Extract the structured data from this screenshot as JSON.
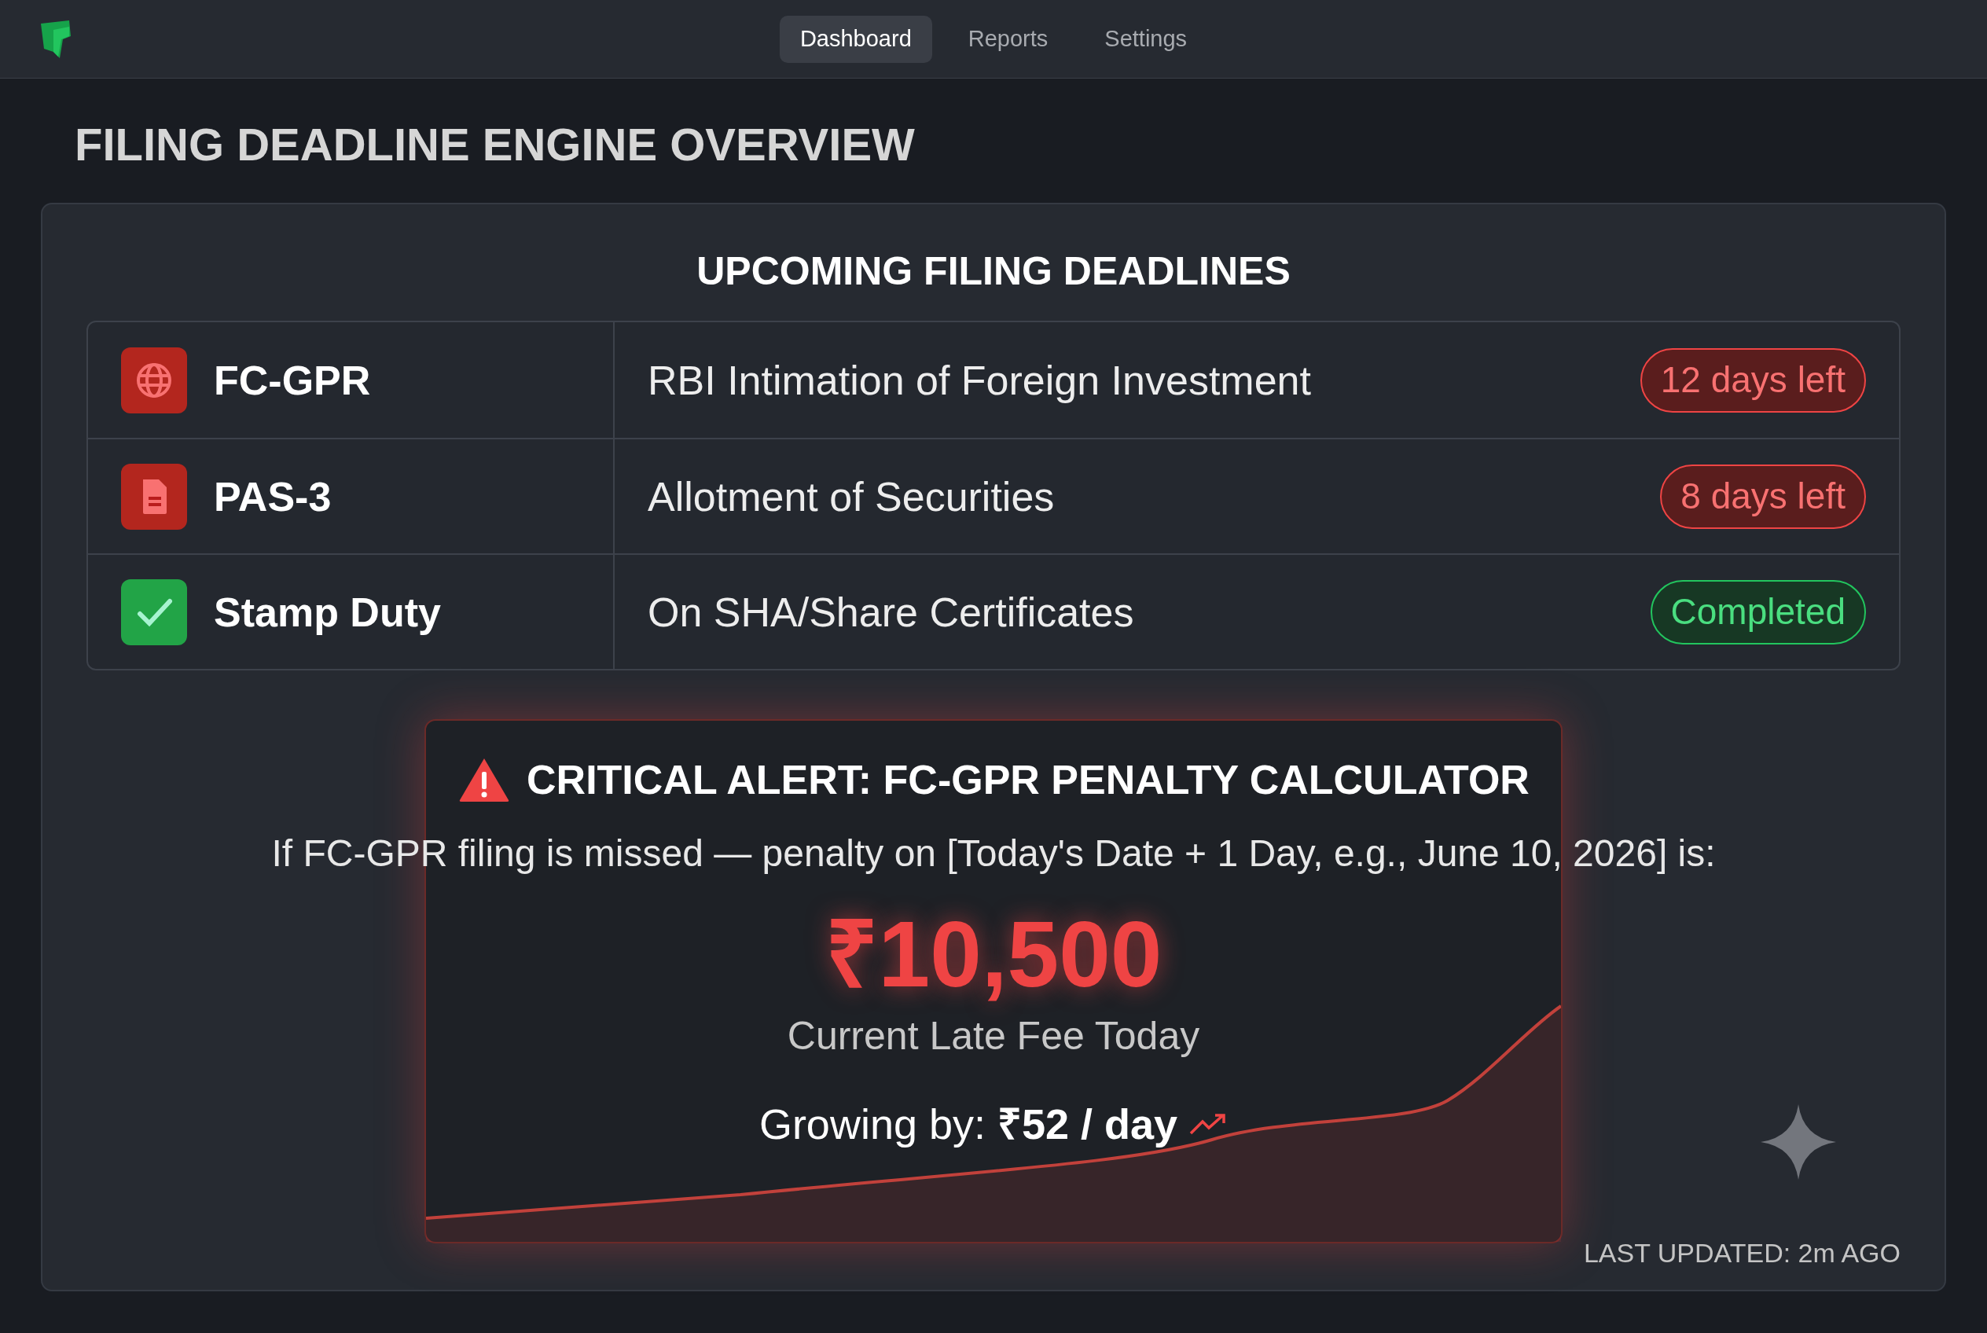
{
  "nav": {
    "tabs": [
      {
        "label": "Dashboard",
        "selected": true
      },
      {
        "label": "Reports",
        "selected": false
      },
      {
        "label": "Settings",
        "selected": false
      }
    ]
  },
  "page_title": "FILING DEADLINE ENGINE OVERVIEW",
  "deadlines": {
    "title": "UPCOMING FILING DEADLINES",
    "rows": [
      {
        "kind": "globe",
        "form": "FC-GPR",
        "description": "RBI Intimation of Foreign Investment",
        "badge": "12 days left"
      },
      {
        "kind": "document",
        "form": "PAS-3",
        "description": "Allotment of Securities",
        "badge": "8 days left"
      },
      {
        "kind": "completed",
        "form": "Stamp Duty",
        "description": "On SHA/Share Certificates",
        "badge": "Completed"
      }
    ]
  },
  "alert": {
    "title": "CRITICAL ALERT: FC-GPR PENALTY CALCULATOR",
    "condition": "If FC-GPR filing is missed — penalty on [Today's Date + 1 Day, e.g., June 10, 2026] is:",
    "amount": "₹10,500",
    "amount_label": "Current Late Fee Today",
    "growth": "Growing by: **₹52 / day**"
  },
  "last_updated": "LAST UPDATED: 2m AGO"
}
